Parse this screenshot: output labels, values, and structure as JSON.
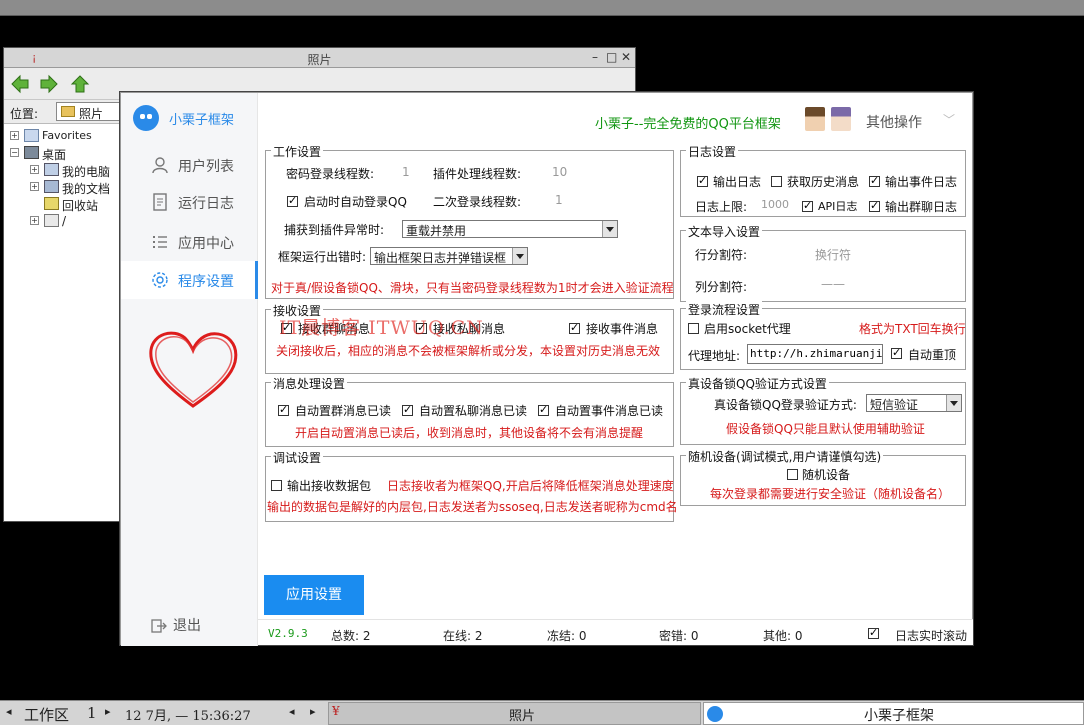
{
  "file_manager": {
    "title": "照片",
    "location_label": "位置:",
    "location_value": "照片",
    "tree": [
      {
        "label": "Favorites"
      },
      {
        "label": "桌面"
      },
      {
        "label": "我的电脑"
      },
      {
        "label": "我的文档"
      },
      {
        "label": "回收站"
      },
      {
        "label": "/"
      }
    ]
  },
  "app": {
    "title": "小栗子框架",
    "slogan": "小栗子--完全免费的QQ平台框架",
    "other_ops": "其他操作",
    "nav": [
      {
        "label": "用户列表",
        "icon": "user-icon"
      },
      {
        "label": "运行日志",
        "icon": "log-icon"
      },
      {
        "label": "应用中心",
        "icon": "list-icon"
      },
      {
        "label": "程序设置",
        "icon": "gear-icon",
        "active": true
      }
    ],
    "logout": "退出",
    "watermark": "IT晨博客 ITWUQ.CN",
    "work": {
      "title": "工作设置",
      "pwd_threads_label": "密码登录线程数:",
      "pwd_threads_value": "1",
      "plugin_threads_label": "插件处理线程数:",
      "plugin_threads_value": "10",
      "auto_login_label": "启动时自动登录QQ",
      "second_threads_label": "二次登录线程数:",
      "second_threads_value": "1",
      "plugin_exception_label": "捕获到插件异常时:",
      "plugin_exception_value": "重载并禁用",
      "framework_error_label": "框架运行出错时:",
      "framework_error_value": "输出框架日志并弹错误框",
      "note": "对于真/假设备锁QQ、滑块，只有当密码登录线程数为1时才会进入验证流程"
    },
    "receive": {
      "title": "接收设置",
      "group_msg": "接收群聊消息",
      "private_msg": "接收私聊消息",
      "event_msg": "接收事件消息",
      "note": "关闭接收后，相应的消息不会被框架解析或分发，本设置对历史消息无效"
    },
    "msgproc": {
      "title": "消息处理设置",
      "auto_read_group": "自动置群消息已读",
      "auto_read_private": "自动置私聊消息已读",
      "auto_read_event": "自动置事件消息已读",
      "note": "开启自动置消息已读后，收到消息时，其他设备将不会有消息提醒"
    },
    "debug": {
      "title": "调试设置",
      "output_packets": "输出接收数据包",
      "note1": "日志接收者为框架QQ,开启后将降低框架消息处理速度",
      "note2": "输出的数据包是解好的内层包,日志发送者为ssoseq,日志发送者昵称为cmd名"
    },
    "logset": {
      "title": "日志设置",
      "output_log": "输出日志",
      "fetch_history": "获取历史消息",
      "output_event_log": "输出事件日志",
      "log_limit_label": "日志上限:",
      "log_limit_value": "1000",
      "api_log": "API日志",
      "output_group_log": "输出群聊日志"
    },
    "textimport": {
      "title": "文本导入设置",
      "row_sep_label": "行分割符:",
      "row_sep_value": "换行符",
      "col_sep_label": "列分割符:",
      "col_sep_value": "——"
    },
    "loginflow": {
      "title": "登录流程设置",
      "socket_proxy": "启用socket代理",
      "format_note": "格式为TXT回车换行",
      "proxy_label": "代理地址:",
      "proxy_value": "http://h.zhimaruanjian",
      "auto_reconnect": "自动重顶"
    },
    "devicelock": {
      "title": "真设备锁QQ验证方式设置",
      "method_label": "真设备锁QQ登录验证方式:",
      "method_value": "短信验证",
      "note": "假设备锁QQ只能且默认使用辅助验证"
    },
    "randdev": {
      "title": "随机设备(调试模式,用户请谨慎勾选)",
      "label": "随机设备",
      "note": "每次登录都需要进行安全验证（随机设备名）"
    },
    "apply_button": "应用设置",
    "status": {
      "version": "V2.9.3",
      "total": "总数: 2",
      "online": "在线: 2",
      "frozen": "冻结: 0",
      "pwd_error": "密错: 0",
      "other": "其他: 0",
      "log_scroll": "日志实时滚动"
    }
  },
  "taskbar": {
    "workspace": "工作区",
    "workspace_num": "1",
    "datetime": "12 7月, — 15:36:27",
    "photos_task": "照片",
    "app_task": "小栗子框架"
  },
  "colors": {
    "accent": "#1a8cf0",
    "green": "#119611",
    "red": "#d61a1a"
  }
}
